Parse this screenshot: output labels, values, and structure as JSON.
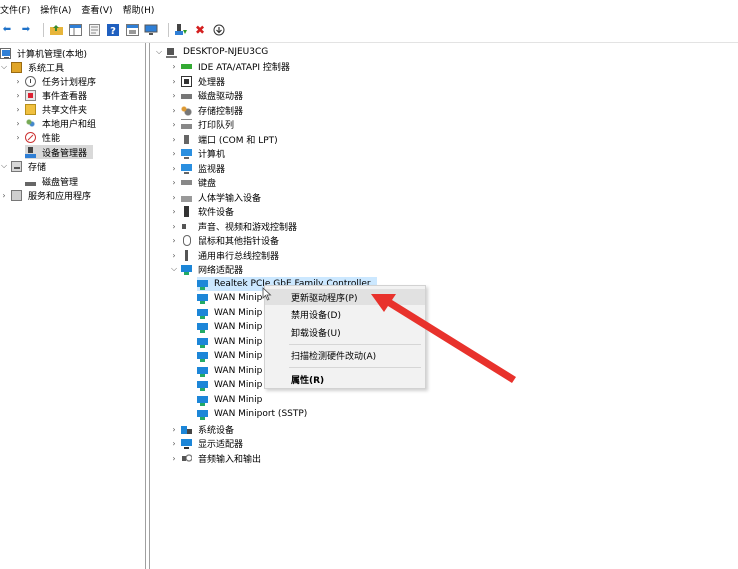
{
  "menubar": {
    "items": [
      "文件(F)",
      "操作(A)",
      "查看(V)",
      "帮助(H)"
    ]
  },
  "toolbar": {
    "icons": [
      "back-arrow-icon",
      "forward-arrow-icon",
      "up-folder-icon",
      "show-tree-icon",
      "properties-icon",
      "help-icon",
      "view-icon",
      "monitor-icon",
      "enable-device-icon",
      "uninstall-x-icon",
      "download-update-icon"
    ]
  },
  "left_tree": {
    "items": [
      {
        "label": "计算机管理(本地)",
        "icon": "computer-icon"
      },
      {
        "label": "系统工具",
        "icon": "tools-icon"
      },
      {
        "label": "任务计划程序",
        "icon": "clock-icon"
      },
      {
        "label": "事件查看器",
        "icon": "event-log-icon"
      },
      {
        "label": "共享文件夹",
        "icon": "shared-folder-icon"
      },
      {
        "label": "本地用户和组",
        "icon": "users-icon"
      },
      {
        "label": "性能",
        "icon": "performance-icon"
      },
      {
        "label": "设备管理器",
        "icon": "device-manager-icon"
      },
      {
        "label": "存储",
        "icon": "storage-icon"
      },
      {
        "label": "磁盘管理",
        "icon": "disk-management-icon"
      },
      {
        "label": "服务和应用程序",
        "icon": "services-icon"
      }
    ]
  },
  "device_tree": {
    "root": "DESKTOP-NJEU3CG",
    "categories": [
      "IDE ATA/ATAPI 控制器",
      "处理器",
      "磁盘驱动器",
      "存储控制器",
      "打印队列",
      "端口 (COM 和 LPT)",
      "计算机",
      "监视器",
      "键盘",
      "人体学输入设备",
      "软件设备",
      "声音、视频和游戏控制器",
      "鼠标和其他指针设备",
      "通用串行总线控制器",
      "网络适配器"
    ],
    "network_children": [
      "Realtek PCIe GbE Family Controller",
      "WAN Minip",
      "WAN Minip",
      "WAN Minip",
      "WAN Minip",
      "WAN Minip",
      "WAN Minip",
      "WAN Minip",
      "WAN Minip",
      "WAN Miniport (SSTP)"
    ],
    "after_categories": [
      "系统设备",
      "显示适配器",
      "音频输入和输出"
    ]
  },
  "context_menu": {
    "update_driver": "更新驱动程序(P)",
    "disable_device": "禁用设备(D)",
    "uninstall_device": "卸载设备(U)",
    "scan_hardware": "扫描检测硬件改动(A)",
    "properties": "属性(R)"
  },
  "colors": {
    "selection": "#cce8ff",
    "arrow": "#e8322c",
    "menu_bg": "#f2f2f2"
  }
}
